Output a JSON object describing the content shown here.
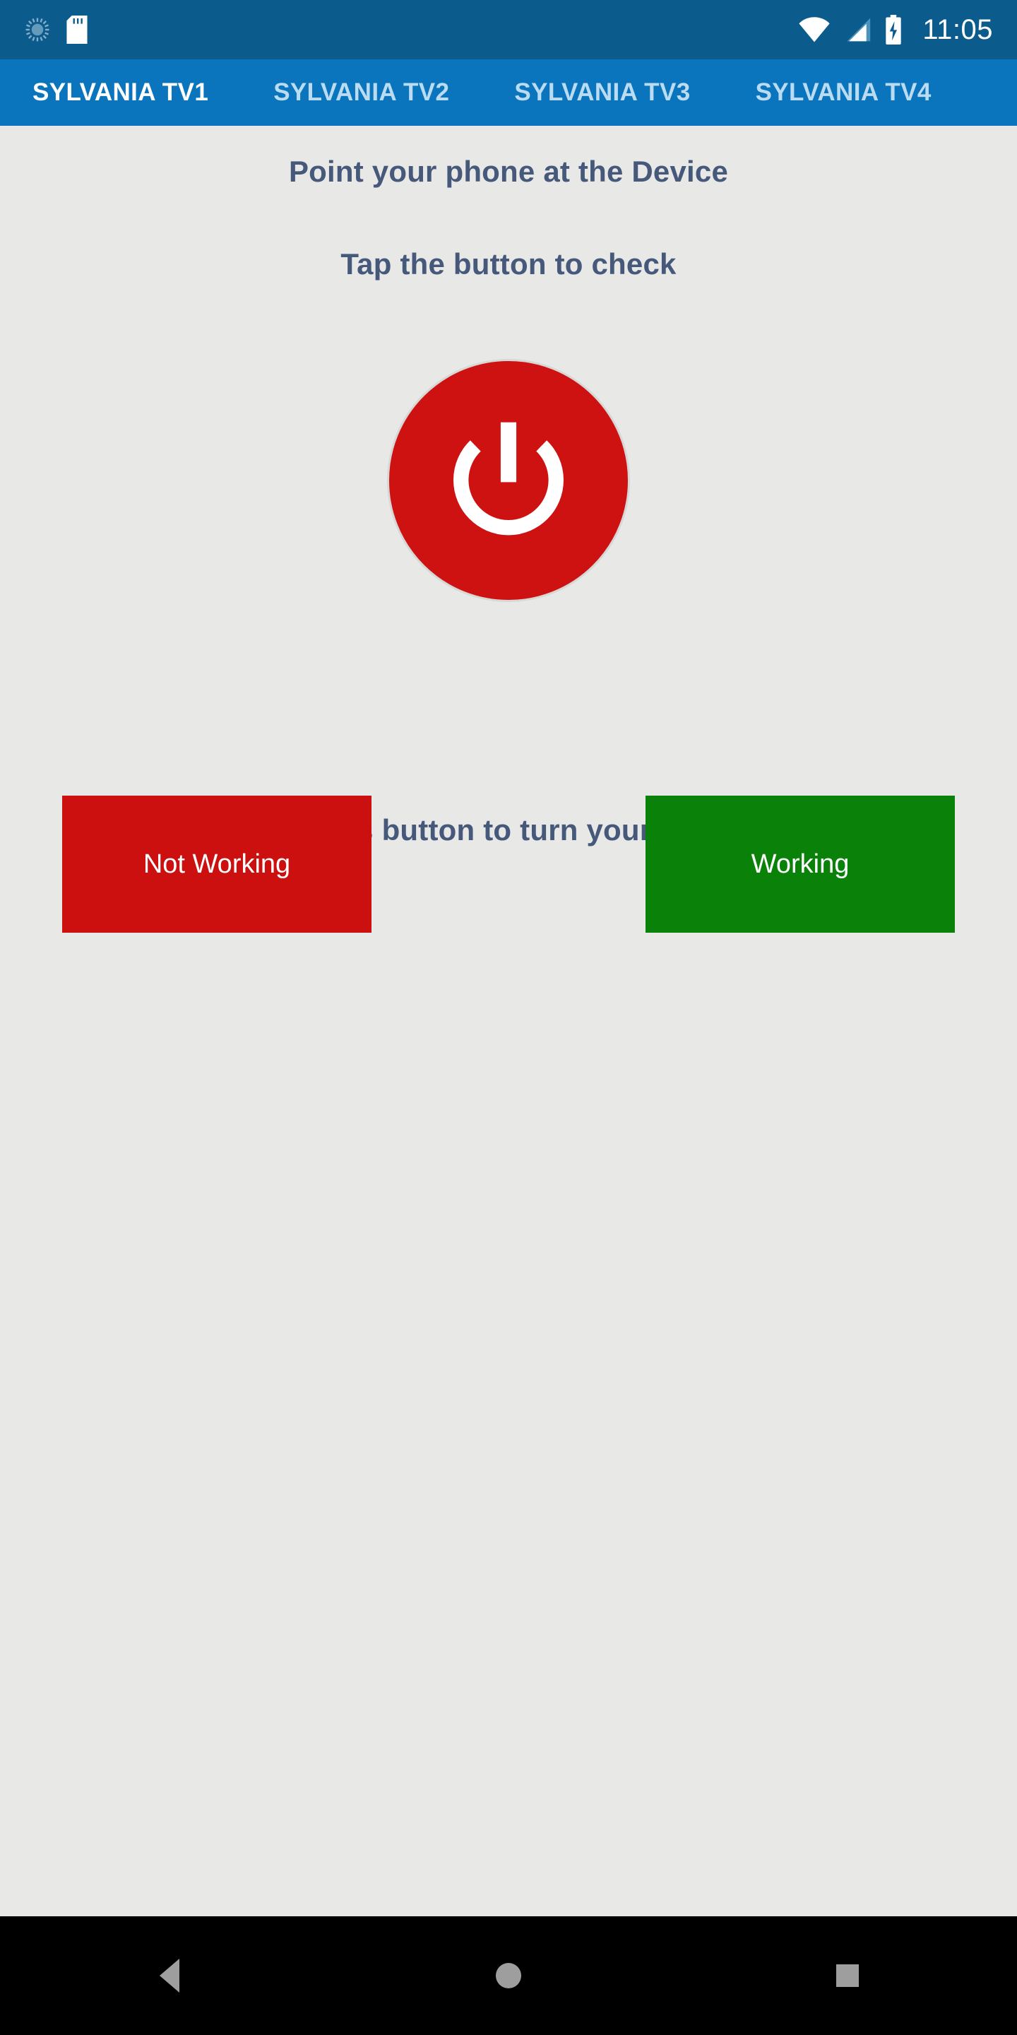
{
  "status_bar": {
    "icons_left": [
      "sync-icon",
      "sd-card-icon"
    ],
    "icons_right": [
      "wifi-icon",
      "cellular-signal-icon",
      "battery-charging-icon"
    ],
    "clock": "11:05",
    "background_color": "#0b5c8c"
  },
  "tab_bar": {
    "background_color": "#0a74bd",
    "active_index": 0,
    "tabs": [
      {
        "label": "SYLVANIA TV1"
      },
      {
        "label": "SYLVANIA TV2"
      },
      {
        "label": "SYLVANIA TV3"
      },
      {
        "label": "SYLVANIA TV4"
      }
    ]
  },
  "main": {
    "background_color": "#e8e8e6",
    "heading_color": "#46597a",
    "heading_point": "Point your phone at the Device",
    "heading_tap_check": "Tap the button to check",
    "heading_tap_turn": "Tap this button to turn your Device",
    "power_button": {
      "icon": "power-icon",
      "color": "#ce1111",
      "border_color": "#d7d7d5"
    },
    "buttons": [
      {
        "label": "Not Working",
        "color": "#cc1010"
      },
      {
        "label": "Working",
        "color": "#0a8209"
      }
    ]
  },
  "nav_bar": {
    "background_color": "#000000",
    "items": [
      {
        "icon": "back-triangle-icon"
      },
      {
        "icon": "home-circle-icon"
      },
      {
        "icon": "recents-square-icon"
      }
    ]
  }
}
